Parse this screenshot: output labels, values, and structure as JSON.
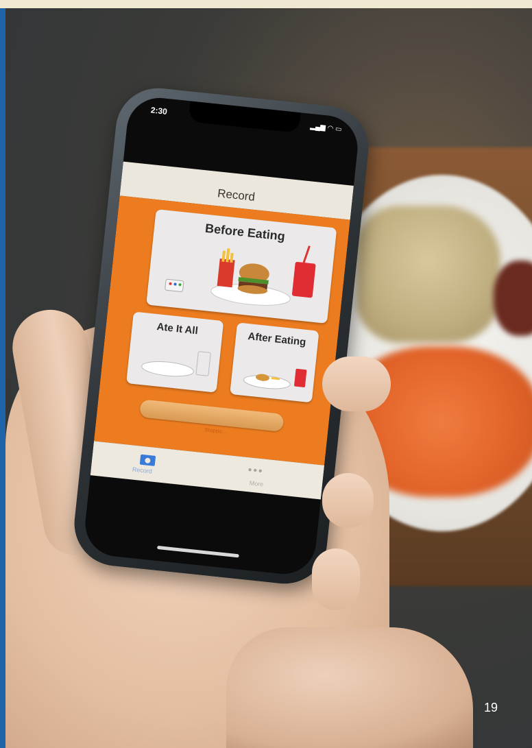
{
  "phone": {
    "status_time": "2:30",
    "app_title": "Record",
    "cards": {
      "before_eating": "Before Eating",
      "ate_it_all": "Ate It All",
      "after_eating": "After Eating"
    },
    "hint": "Stoppo...",
    "tabs": {
      "record": "Record",
      "more": "More"
    },
    "accent_color": "#ec7c1f"
  },
  "page_number": "19"
}
